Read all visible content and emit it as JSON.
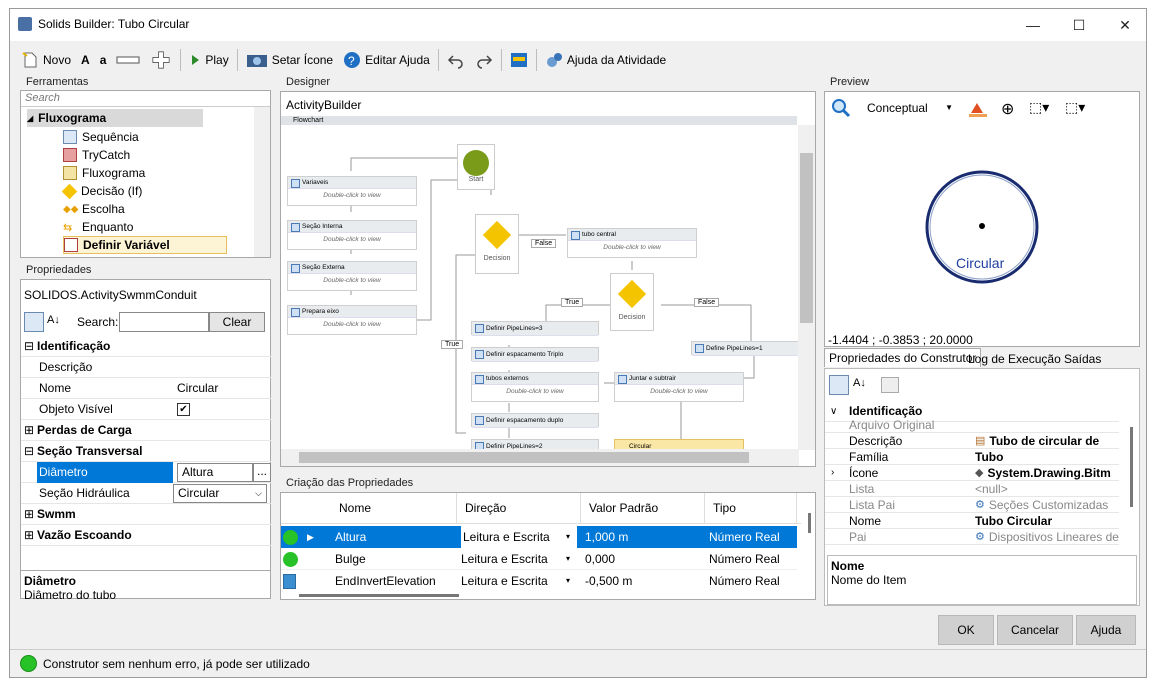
{
  "window": {
    "title": "Solids Builder: Tubo Circular",
    "minimize": "—",
    "maximize": "☐",
    "close": "✕"
  },
  "toolbar": {
    "novo": "Novo",
    "font_big": "A",
    "font_small": "a",
    "play": "Play",
    "setar_icone": "Setar Ícone",
    "editar_ajuda": "Editar Ajuda",
    "ajuda_atividade": "Ajuda da Atividade"
  },
  "ferramentas": {
    "title": "Ferramentas",
    "search_placeholder": "Search",
    "group": "Fluxograma",
    "items": [
      "Sequência",
      "TryCatch",
      "Fluxograma",
      "Decisão (If)",
      "Escolha",
      "Enquanto",
      "Definir Variável"
    ]
  },
  "propriedades": {
    "title": "Propriedades",
    "object": "SOLIDOS.ActivitySwmmConduit",
    "search_label": "Search:",
    "clear": "Clear",
    "rows": [
      {
        "key": "Identificação",
        "value": ""
      },
      {
        "key": "Descrição",
        "value": ""
      },
      {
        "key": "Nome",
        "value": "Circular"
      },
      {
        "key": "Objeto Visível",
        "value": "✔"
      },
      {
        "key": "Perdas de Carga",
        "value": ""
      },
      {
        "key": "Seção Transversal",
        "value": ""
      },
      {
        "key": "Diâmetro",
        "value": "Altura"
      },
      {
        "key": "Seção Hidráulica",
        "value": "Circular"
      },
      {
        "key": "Swmm",
        "value": ""
      },
      {
        "key": "Vazão Escoando",
        "value": ""
      }
    ],
    "desc_title": "Diâmetro",
    "desc_text": "Diâmetro do tubo",
    "ellipsis": "...",
    "expand": "⊞",
    "collapse": "⊟"
  },
  "designer": {
    "title": "Designer",
    "breadcrumb": "ActivityBuilder",
    "flowchart": "Flowchart",
    "start": "Start",
    "decision": "Decision",
    "dblclick": "Double-click to view",
    "true": "True",
    "false": "False",
    "nodes": [
      "Variaveis",
      "Seção Interna",
      "Seção Externa",
      "Prepara eixo",
      "tubo central",
      "Definir PipeLines=3",
      "Definir espacamento Triplo",
      "tubos externos",
      "Definir espacamento duplo",
      "Definir PipeLines=2",
      "Juntar e subtrair",
      "Circular",
      "Define PipeLines=1"
    ]
  },
  "criacao": {
    "title": "Criação das Propriedades",
    "headers": [
      "Nome",
      "Direção",
      "Valor Padrão",
      "Tipo"
    ],
    "rows": [
      {
        "nome": "Altura",
        "direcao": "Leitura e Escrita",
        "valor": "1,000 m",
        "tipo": "Número Real"
      },
      {
        "nome": "Bulge",
        "direcao": "Leitura e Escrita",
        "valor": "0,000",
        "tipo": "Número Real"
      },
      {
        "nome": "EndInvertElevation",
        "direcao": "Leitura e Escrita",
        "valor": "-0,500 m",
        "tipo": "Número Real"
      }
    ]
  },
  "preview": {
    "title": "Preview",
    "mode": "Conceptual",
    "label": "Circular",
    "coords": "-1.4404 ; -0.3853 ; 20.0000"
  },
  "construtor": {
    "tabs": [
      "Propriedades do Construtor",
      "Log de Execução",
      "Saídas"
    ],
    "rows": [
      {
        "key": "Identificação",
        "value": ""
      },
      {
        "key": "Arquivo Original",
        "value": ""
      },
      {
        "key": "Descrição",
        "value": "Tubo de circular de"
      },
      {
        "key": "Família",
        "value": "Tubo"
      },
      {
        "key": "Ícone",
        "value": "System.Drawing.Bitm"
      },
      {
        "key": "Lista",
        "value": "<null>"
      },
      {
        "key": "Lista Pai",
        "value": "Seções Customizadas"
      },
      {
        "key": "Nome",
        "value": "Tubo Circular"
      },
      {
        "key": "Pai",
        "value": "Dispositivos Lineares de"
      }
    ],
    "desc_title": "Nome",
    "desc_text": "Nome do Item"
  },
  "buttons": {
    "ok": "OK",
    "cancelar": "Cancelar",
    "ajuda": "Ajuda"
  },
  "status": "Construtor sem nenhum erro, já pode ser utilizado"
}
